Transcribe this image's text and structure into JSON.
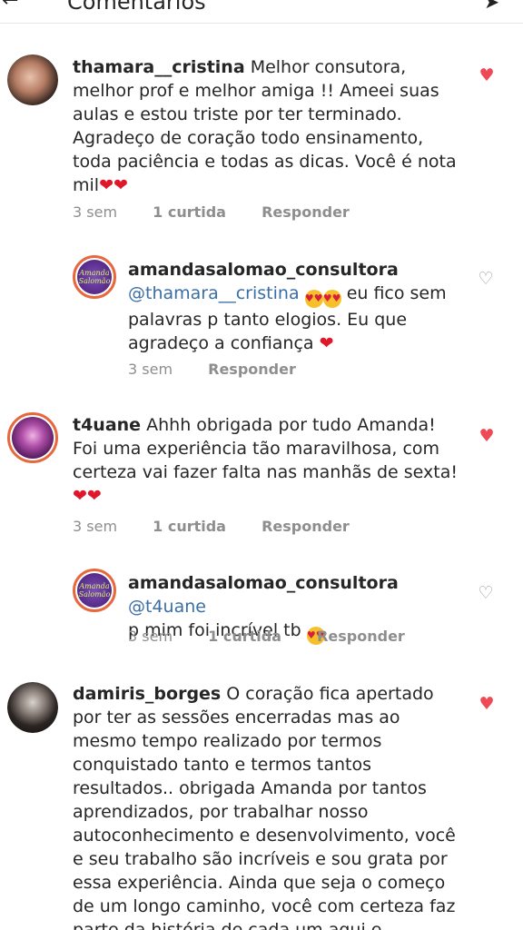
{
  "header": {
    "title": "Comentários",
    "back_icon": "arrow-left-icon",
    "share_icon": "send-icon"
  },
  "comments": [
    {
      "username": "thamara__cristina",
      "text": "Melhor consutora, melhor prof e melhor amiga !! Ameei suas aulas e estou triste por ter terminado. Agradeço de coração todo ensinamento, toda paciência e todas as dicas. Você é nota mil",
      "emojis": "❤❤",
      "time": "3 sem",
      "likes": "1 curtida",
      "reply": "Responder",
      "liked": true
    },
    {
      "username": "amandasalomao_consultora",
      "mention": "@thamara__cristina",
      "text": "eu fico sem palavras p tanto elogios. Eu que agradeço a confiança",
      "time": "3 sem",
      "reply": "Responder",
      "liked": false,
      "avatar_text": "Amanda Salomão"
    },
    {
      "username": "t4uane",
      "text": "Ahhh obrigada por tudo Amanda! Foi uma experiência tão maravilhosa, com certeza vai fazer falta nas manhãs de sexta!",
      "emojis": "❤❤",
      "time": "3 sem",
      "likes": "1 curtida",
      "reply": "Responder",
      "liked": true
    },
    {
      "username": "amandasalomao_consultora",
      "mention": "@t4uane",
      "text": "p mim foi incrível tb",
      "time": "3 sem",
      "likes": "1 curtida",
      "reply": "Responder",
      "liked": false,
      "avatar_text": "Amanda Salomão"
    },
    {
      "username": "damiris_borges",
      "text": "O coração fica apertado por ter as sessões encerradas mas ao mesmo tempo realizado por termos conquistado tanto e termos tantos resultados.. obrigada Amanda por tantos aprendizados, por trabalhar nosso autoconhecimento e desenvolvimento, você e seu trabalho são incríveis e sou grata por essa experiência. Ainda que seja o começo de um longo caminho, você com certeza faz parte da história de cada um aqui e sinceramente",
      "liked": true
    }
  ],
  "colors": {
    "like_red": "#ed4956",
    "mention_blue": "#3a6ea5",
    "meta_gray": "#8e8e8e"
  }
}
